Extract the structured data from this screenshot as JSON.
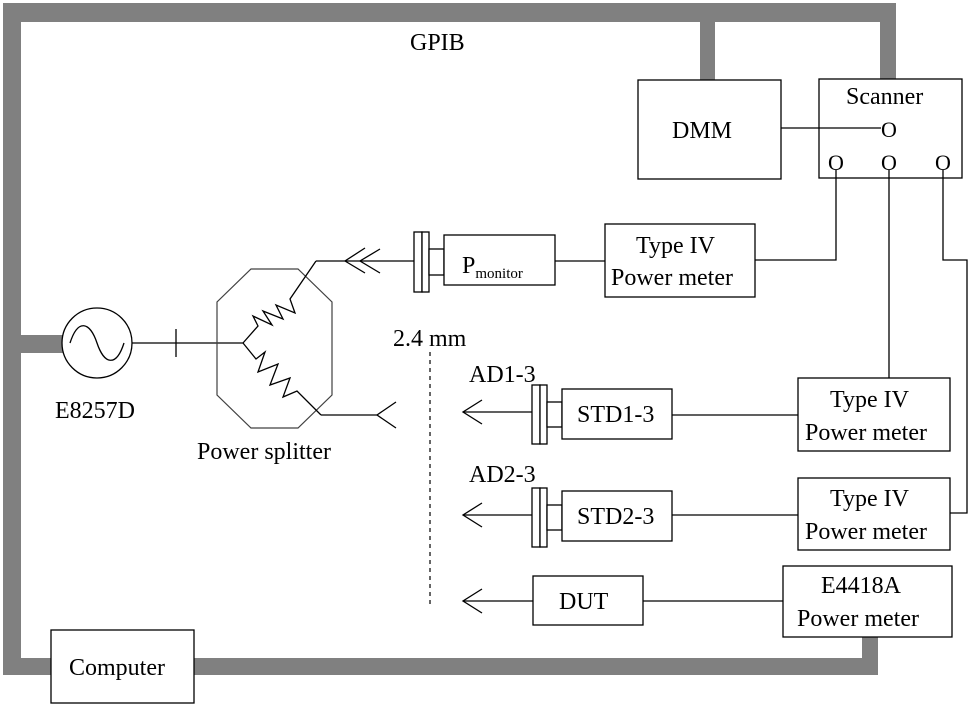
{
  "diagram": {
    "bus_label": "GPIB",
    "instruments": {
      "dmm": "DMM",
      "scanner": "Scanner",
      "scanner_port_glyph": "O",
      "signal_generator": "E8257D",
      "power_splitter": "Power splitter",
      "monitor_sensor_main": "P",
      "monitor_sensor_sub": "monitor",
      "type_iv_meter_1": {
        "line1": "Type IV",
        "line2": "Power meter"
      },
      "type_iv_meter_2": {
        "line1": "Type IV",
        "line2": "Power meter"
      },
      "type_iv_meter_3": {
        "line1": "Type IV",
        "line2": "Power meter"
      },
      "e4418a_meter": {
        "line1": "E4418A",
        "line2": "Power meter"
      },
      "std1": "STD1-3",
      "std2": "STD2-3",
      "dut": "DUT",
      "computer": "Computer"
    },
    "labels": {
      "connector_size": "2.4 mm",
      "adapter1": "AD1-3",
      "adapter2": "AD2-3"
    },
    "colors": {
      "bus": "#808080",
      "line": "#000000",
      "background": "#ffffff"
    }
  }
}
